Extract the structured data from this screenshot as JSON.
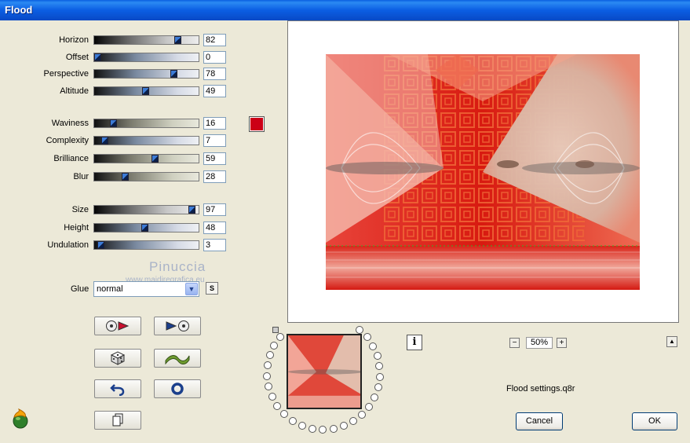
{
  "window": {
    "title": "Flood"
  },
  "sliders": [
    {
      "label": "Horizon",
      "value": "82",
      "pct": 0.82,
      "style": ""
    },
    {
      "label": "Offset",
      "value": "0",
      "pct": 0.0,
      "style": "b"
    },
    {
      "label": "Perspective",
      "value": "78",
      "pct": 0.78,
      "style": "b"
    },
    {
      "label": "Altitude",
      "value": "49",
      "pct": 0.49,
      "style": "b"
    },
    {
      "label": "Waviness",
      "value": "16",
      "pct": 0.16,
      "style": "c"
    },
    {
      "label": "Complexity",
      "value": "7",
      "pct": 0.07,
      "style": "b"
    },
    {
      "label": "Brilliance",
      "value": "59",
      "pct": 0.59,
      "style": "c"
    },
    {
      "label": "Blur",
      "value": "28",
      "pct": 0.28,
      "style": "c"
    },
    {
      "label": "Size",
      "value": "97",
      "pct": 0.97,
      "style": ""
    },
    {
      "label": "Height",
      "value": "48",
      "pct": 0.48,
      "style": "b"
    },
    {
      "label": "Undulation",
      "value": "3",
      "pct": 0.03,
      "style": "b"
    }
  ],
  "color_swatch": "#cc0016",
  "watermark": {
    "name": "Pinuccia",
    "site": "www.maidiregrafica.eu"
  },
  "glue": {
    "label": "Glue",
    "value": "normal"
  },
  "s_button": "S",
  "preview": {
    "zoom": "50%",
    "settings_file": "Flood settings.q8r"
  },
  "buttons": {
    "cancel": "Cancel",
    "ok": "OK"
  }
}
